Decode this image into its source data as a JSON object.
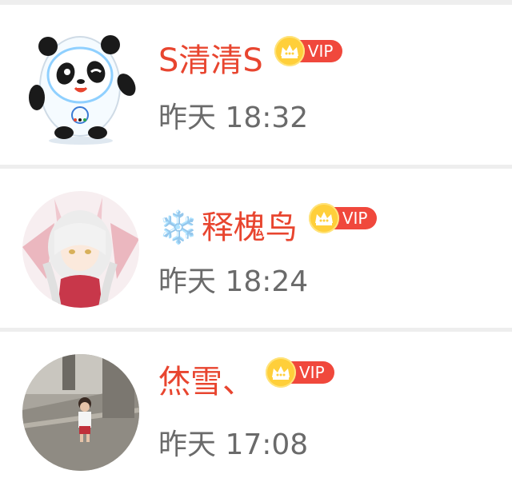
{
  "comments": [
    {
      "username": "S清清S",
      "name_prefix_icon": "",
      "badge": {
        "icon": "crown-icon",
        "label": "VIP"
      },
      "time": "昨天 18:32",
      "avatar": "panda-mascot-avatar"
    },
    {
      "username": "释槐鸟",
      "name_prefix_icon": "❄️",
      "badge": {
        "icon": "crown-icon",
        "label": "VIP"
      },
      "time": "昨天 18:24",
      "avatar": "anime-girl-avatar"
    },
    {
      "username": "烋雪、",
      "name_prefix_icon": "",
      "badge": {
        "icon": "crown-icon",
        "label": "VIP"
      },
      "time": "昨天 17:08",
      "avatar": "child-photo-avatar"
    }
  ],
  "colors": {
    "username": "#e8452f",
    "time": "#6a6a6a",
    "vip_bg": "#f0483c",
    "crown_bg": "#ffcf3a",
    "divider": "#eeeeee"
  }
}
